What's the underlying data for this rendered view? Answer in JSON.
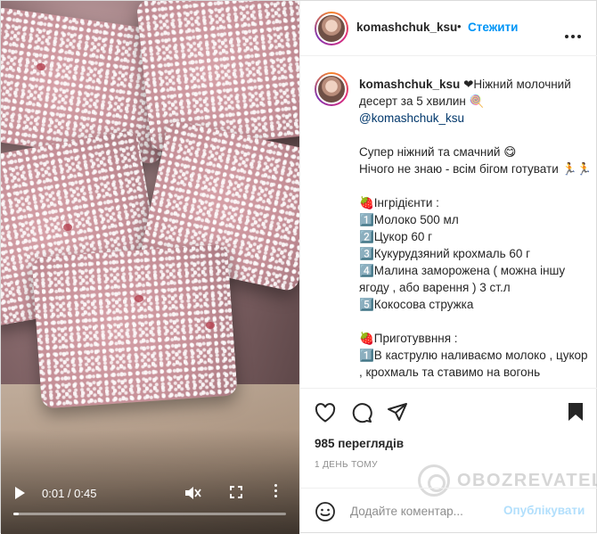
{
  "video": {
    "time": "0:01 / 0:45",
    "progress": 0.02
  },
  "header": {
    "username": "komashchuk_ksu",
    "separator": "•",
    "follow_label": "Стежити"
  },
  "caption": {
    "username": "komashchuk_ksu",
    "lines": [
      "❤Ніжний молочний десерт за 5 хвилин 🍭",
      "@komashchuk_ksu",
      "",
      "Супер ніжний та смачний 😋",
      "Нічого не знаю - всім бігом готувати 🏃🏃",
      "",
      "🍓Інгрідієнти :",
      "1️⃣Молоко 500 мл",
      "2️⃣Цукор 60 г",
      "3️⃣Кукурудзяний крохмаль 60 г",
      "4️⃣Малина заморожена ( можна іншу ягоду , або варення ) 3 ст.л",
      "5️⃣Кокосова стружка",
      "",
      "🍓Приготуввння :",
      "1️⃣В каструлю наливаємо молоко , цукор , крохмаль та ставимо на вогонь"
    ]
  },
  "stats": {
    "views": "985 переглядів",
    "ago": "1 ДЕНЬ ТОМУ"
  },
  "watermark": "OBOZREVATEL",
  "comment": {
    "placeholder": "Додайте коментар...",
    "publish_label": "Опублікувати"
  },
  "colors": {
    "link": "#0095f6",
    "publish_disabled": "#b2dffc",
    "text": "#262626",
    "muted": "#8e8e8e"
  }
}
